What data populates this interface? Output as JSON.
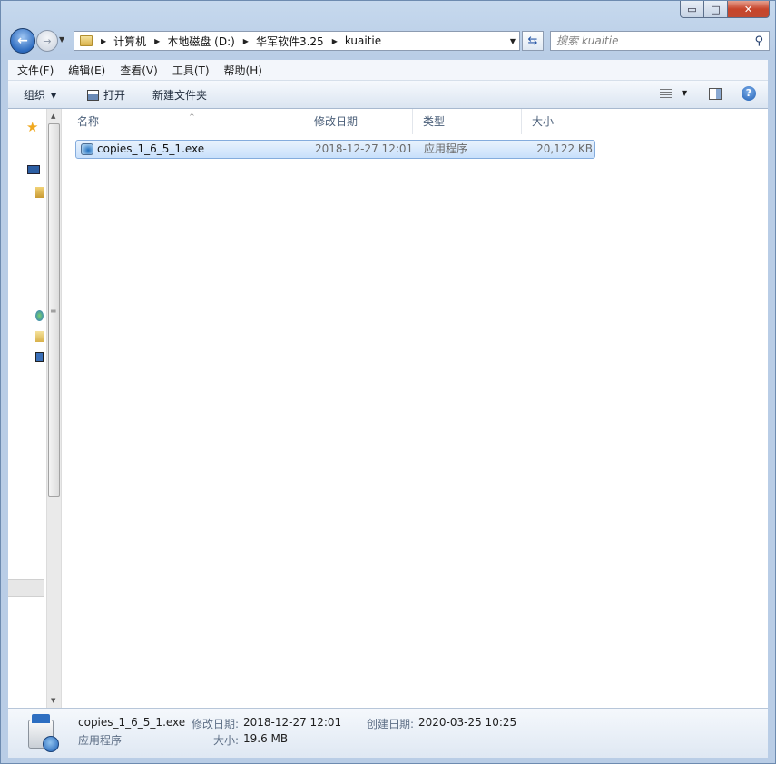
{
  "window": {
    "controls": {
      "minimize": "▭",
      "maximize": "□",
      "close": "✕"
    }
  },
  "nav": {
    "back_glyph": "←",
    "forward_glyph": "→",
    "breadcrumbs": [
      "计算机",
      "本地磁盘 (D:)",
      "华军软件3.25",
      "kuaitie"
    ],
    "refresh_glyph": "⇆",
    "search_placeholder": "搜索 kuaitie"
  },
  "menu": [
    "文件(F)",
    "编辑(E)",
    "查看(V)",
    "工具(T)",
    "帮助(H)"
  ],
  "toolbar": {
    "organize": "组织",
    "open": "打开",
    "new_folder": "新建文件夹",
    "help": "?"
  },
  "columns": {
    "name": "名称",
    "date_modified": "修改日期",
    "type": "类型",
    "size": "大小"
  },
  "files": [
    {
      "name": "copies_1_6_5_1.exe",
      "date_modified": "2018-12-27 12:01",
      "type": "应用程序",
      "size": "20,122 KB"
    }
  ],
  "details": {
    "name": "copies_1_6_5_1.exe",
    "type": "应用程序",
    "modified_label": "修改日期:",
    "modified_value": "2018-12-27 12:01",
    "created_label": "创建日期:",
    "created_value": "2020-03-25 10:25",
    "size_label": "大小:",
    "size_value": "19.6 MB"
  },
  "colors": {
    "accent": "#2e6cc0",
    "selection": "#c8e0fb",
    "selection_border": "#84acdd",
    "chrome": "#b9cde6",
    "close": "#c7452b"
  }
}
